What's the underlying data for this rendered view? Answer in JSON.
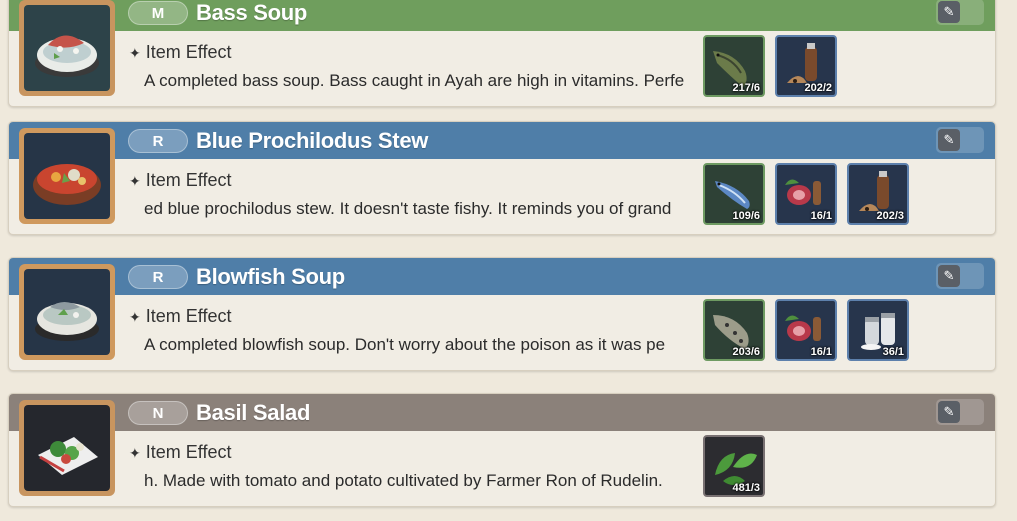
{
  "effect_label": "Item Effect",
  "pin_symbol": "📌",
  "recipes": [
    {
      "grade": "M",
      "name": "Bass Soup",
      "description": "A completed bass soup. Bass caught in Ayah are high in vitamins. Perfe",
      "thumb_icon": "bass-soup-icon",
      "ingredients": [
        {
          "icon": "bass-fish-icon",
          "qty": "217/6",
          "rarity": "green"
        },
        {
          "icon": "pepper-grinder-icon",
          "qty": "202/2",
          "rarity": "blue"
        }
      ]
    },
    {
      "grade": "R",
      "name": "Blue Prochilodus Stew",
      "description": "ed blue prochilodus stew. It doesn't taste fishy. It reminds you of grand",
      "thumb_icon": "prochilodus-stew-icon",
      "ingredients": [
        {
          "icon": "blue-fish-icon",
          "qty": "109/6",
          "rarity": "green"
        },
        {
          "icon": "meat-vegetable-icon",
          "qty": "16/1",
          "rarity": "blue"
        },
        {
          "icon": "pepper-grinder-icon",
          "qty": "202/3",
          "rarity": "blue"
        }
      ]
    },
    {
      "grade": "R",
      "name": "Blowfish Soup",
      "description": "A completed blowfish soup. Don't worry about the poison as it was pe",
      "thumb_icon": "blowfish-soup-icon",
      "ingredients": [
        {
          "icon": "blowfish-icon",
          "qty": "203/6",
          "rarity": "green"
        },
        {
          "icon": "meat-vegetable-icon",
          "qty": "16/1",
          "rarity": "blue"
        },
        {
          "icon": "salt-shaker-icon",
          "qty": "36/1",
          "rarity": "blue"
        }
      ]
    },
    {
      "grade": "N",
      "name": "Basil Salad",
      "description": "h. Made with tomato and potato cultivated by Farmer Ron of Rudelin.",
      "thumb_icon": "basil-salad-icon",
      "ingredients": [
        {
          "icon": "basil-leaf-icon",
          "qty": "481/3",
          "rarity": "gray"
        }
      ]
    }
  ]
}
